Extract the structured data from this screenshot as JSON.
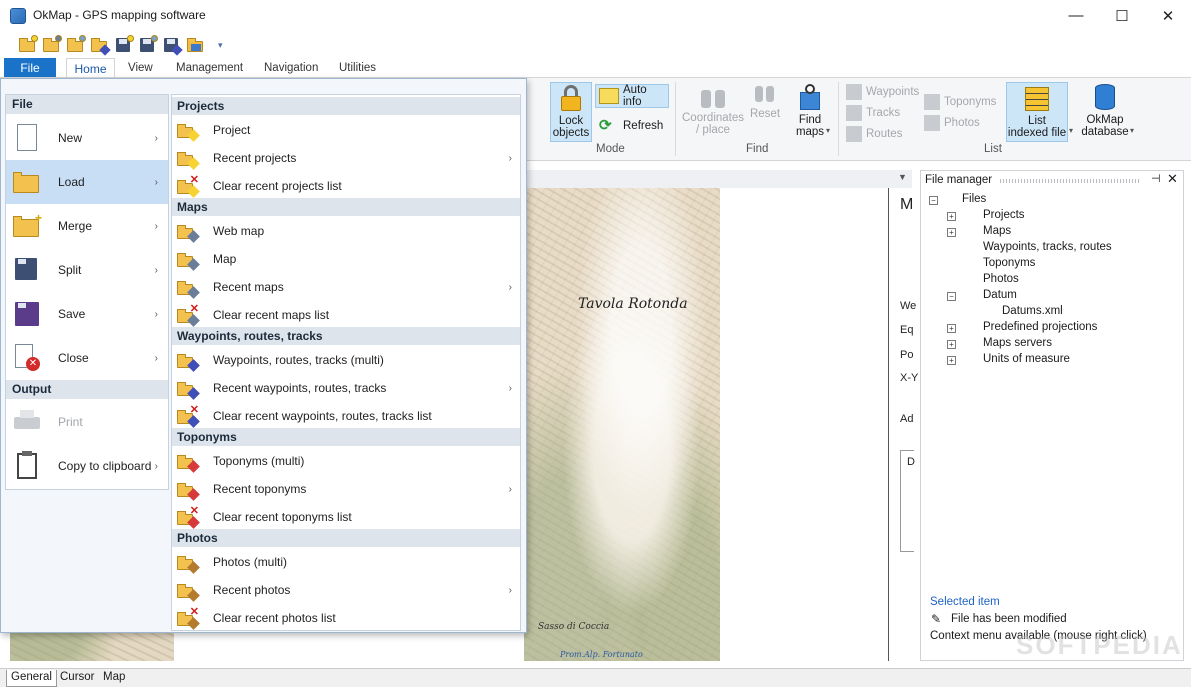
{
  "window": {
    "title": "OkMap - GPS mapping software",
    "minimize": "—",
    "maximize": "☐",
    "close": "✕"
  },
  "quick_access": {
    "dropdown": "▾"
  },
  "ribbon_tabs": {
    "file": "File",
    "home": "Home",
    "view": "View",
    "management": "Management",
    "navigation": "Navigation",
    "utilities": "Utilities"
  },
  "ribbon": {
    "mode": {
      "label": "Mode",
      "lock": "Lock objects",
      "lock_line1": "Lock",
      "lock_line2": "objects",
      "auto_info": "Auto info",
      "refresh": "Refresh"
    },
    "find": {
      "label": "Find",
      "coordinates_line1": "Coordinates",
      "coordinates_line2": "/ place",
      "reset": "Reset",
      "find_maps_line1": "Find",
      "find_maps_line2": "maps"
    },
    "list": {
      "label": "List",
      "waypoints": "Waypoints",
      "tracks": "Tracks",
      "routes": "Routes",
      "toponyms": "Toponyms",
      "photos": "Photos",
      "list_indexed_line1": "List",
      "list_indexed_line2": "indexed file",
      "okmap_db_line1": "OkMap",
      "okmap_db_line2": "database"
    }
  },
  "file_menu": {
    "left": {
      "file_header": "File",
      "output_header": "Output",
      "items": [
        {
          "label": "New",
          "arrow": "›"
        },
        {
          "label": "Load",
          "arrow": "›"
        },
        {
          "label": "Merge",
          "arrow": "›"
        },
        {
          "label": "Split",
          "arrow": "›"
        },
        {
          "label": "Save",
          "arrow": "›"
        },
        {
          "label": "Close",
          "arrow": "›"
        }
      ],
      "output_items": [
        {
          "label": "Print"
        },
        {
          "label": "Copy to clipboard",
          "arrow": "›"
        }
      ]
    },
    "right": {
      "sections": {
        "projects": "Projects",
        "maps": "Maps",
        "wrt": "Waypoints, routes, tracks",
        "toponyms": "Toponyms",
        "photos": "Photos"
      },
      "projects": [
        "Project",
        "Recent projects",
        "Clear recent projects list"
      ],
      "maps": [
        "Web map",
        "Map",
        "Recent maps",
        "Clear recent maps list"
      ],
      "wrt": [
        "Waypoints, routes, tracks (multi)",
        "Recent waypoints, routes, tracks",
        "Clear recent waypoints, routes, tracks list"
      ],
      "toponyms": [
        "Toponyms (multi)",
        "Recent toponyms",
        "Clear recent toponyms list"
      ],
      "photos": [
        "Photos (multi)",
        "Recent photos",
        "Clear recent photos list"
      ],
      "arrow": "›"
    }
  },
  "map": {
    "label_main": "Tavola Rotonda",
    "label_small": "Sasso di Coccia",
    "label_tiny": "Prom.Alp. Fortunato"
  },
  "info_fragments": {
    "m": "M",
    "we": "We",
    "eq": "Eq",
    "po": "Po",
    "xy": "X-Y",
    "ad": "Ad",
    "d": "D"
  },
  "file_manager": {
    "title": "File manager",
    "pin": "⊣",
    "close": "✕",
    "tree": {
      "root": "Files",
      "items": [
        "Projects",
        "Maps",
        "Waypoints, tracks, routes",
        "Toponyms",
        "Photos",
        "Datum",
        "Predefined projections",
        "Maps servers",
        "Units of measure"
      ],
      "datum_child": "Datums.xml"
    },
    "selected_item": "Selected item",
    "modified": "File has been modified",
    "context": "Context menu available (mouse right click)"
  },
  "watermark": "SOFTPEDIA",
  "bottom_tabs": [
    "General",
    "Cursor",
    "Map"
  ],
  "colors": {
    "file_tab": "#1a73c9",
    "highlight": "#cde6f7",
    "accent_text": "#1f63c6"
  }
}
